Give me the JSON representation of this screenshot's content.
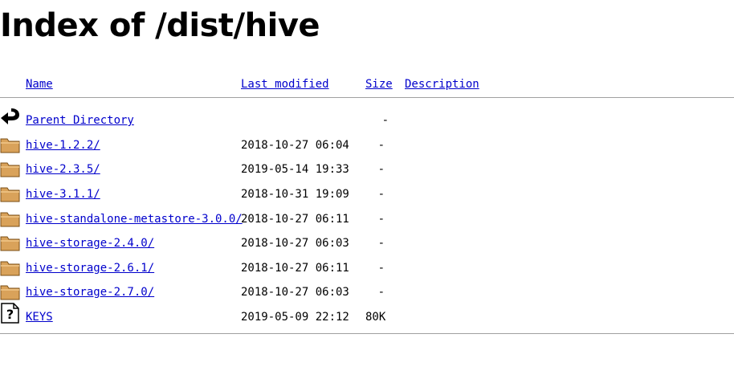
{
  "title": "Index of /dist/hive",
  "columns": {
    "name": "Name",
    "last_modified": "Last modified",
    "size": "Size",
    "description": "Description"
  },
  "rows": [
    {
      "icon": "back-arrow-icon",
      "name": "Parent Directory",
      "modified": "",
      "size": "-"
    },
    {
      "icon": "folder-icon",
      "name": "hive-1.2.2/",
      "modified": "2018-10-27 06:04",
      "size": "-"
    },
    {
      "icon": "folder-icon",
      "name": "hive-2.3.5/",
      "modified": "2019-05-14 19:33",
      "size": "-"
    },
    {
      "icon": "folder-icon",
      "name": "hive-3.1.1/",
      "modified": "2018-10-31 19:09",
      "size": "-"
    },
    {
      "icon": "folder-icon",
      "name": "hive-standalone-metastore-3.0.0/",
      "modified": "2018-10-27 06:11",
      "size": "-"
    },
    {
      "icon": "folder-icon",
      "name": "hive-storage-2.4.0/",
      "modified": "2018-10-27 06:03",
      "size": "-"
    },
    {
      "icon": "folder-icon",
      "name": "hive-storage-2.6.1/",
      "modified": "2018-10-27 06:11",
      "size": "-"
    },
    {
      "icon": "folder-icon",
      "name": "hive-storage-2.7.0/",
      "modified": "2018-10-27 06:03",
      "size": "-"
    },
    {
      "icon": "unknown-file-icon",
      "name": "KEYS",
      "modified": "2019-05-09 22:12",
      "size": "80K"
    }
  ],
  "colors": {
    "link": "#0000cc",
    "folder": "#d9a25a",
    "rule": "#a0a0a0"
  }
}
